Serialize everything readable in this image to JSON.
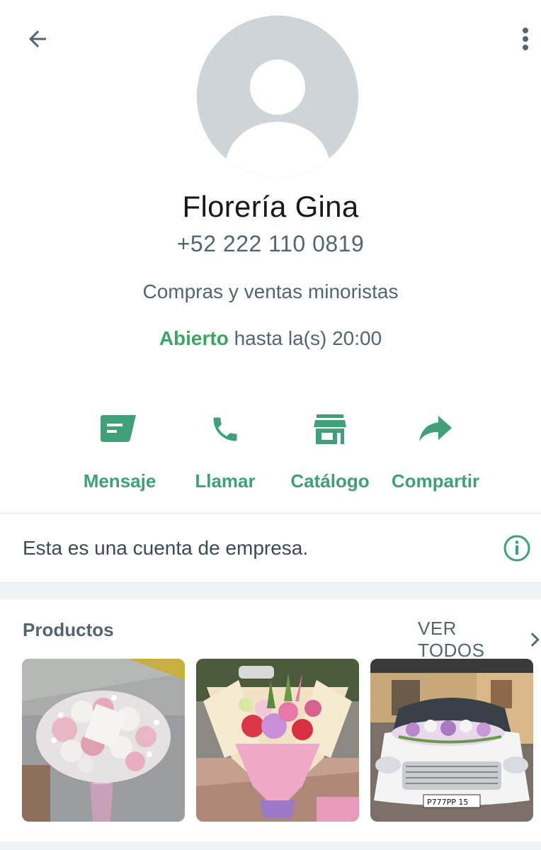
{
  "header": {
    "back_icon": "arrow-left-icon",
    "menu_icon": "more-vertical-icon"
  },
  "profile": {
    "avatar_icon": "default-avatar-icon",
    "name": "Florería Gina",
    "phone": "+52 222 110 0819",
    "category": "Compras y ventas minoristas",
    "status_open": "Abierto",
    "status_hours": "hasta la(s) 20:00"
  },
  "actions": [
    {
      "label": "Mensaje",
      "icon": "message-icon"
    },
    {
      "label": "Llamar",
      "icon": "phone-icon"
    },
    {
      "label": "Catálogo",
      "icon": "storefront-icon"
    },
    {
      "label": "Compartir",
      "icon": "share-icon"
    }
  ],
  "business_notice": {
    "text": "Esta es una cuenta de empresa.",
    "icon": "info-icon"
  },
  "products": {
    "title": "Productos",
    "see_all": "VER TODOS",
    "items": [
      {
        "image": "pink-white-rose-bouquet"
      },
      {
        "image": "mixed-flower-bouquet-pink-wrap"
      },
      {
        "image": "wedding-car-floral-arrangement"
      }
    ]
  },
  "colors": {
    "accent": "#3fa07a",
    "open_green": "#3fa362",
    "text_secondary": "#54656f"
  }
}
